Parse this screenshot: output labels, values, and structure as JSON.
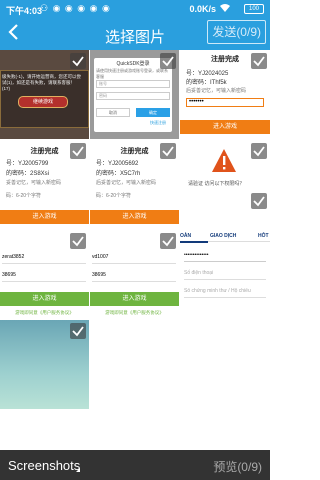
{
  "status": {
    "time": "下午4:03",
    "network": "0.0K/s",
    "battery": "100"
  },
  "header": {
    "title": "选择图片",
    "send_label": "发送(0/9)"
  },
  "thumbs": {
    "t1": {
      "text": "级失败(-1)，请开始运营商，您还可以尝试(1)，如还是有失败，请联系客服！(17)",
      "button": "继续游戏"
    },
    "t2": {
      "title": "QuickSDK登录",
      "hint": "请使用快速注册或游戏账号登录，或联系客服",
      "account": "账号",
      "password": "密码",
      "cancel": "取消",
      "ok": "确定",
      "register": "快速注册"
    },
    "t3": {
      "title": "注册完成",
      "account": "号：YJ2024025",
      "password": "的密码：IThf5k",
      "tip": "后妥善记忆，可输入新密码",
      "field": "•••••••",
      "button": "进入游戏"
    },
    "t4": {
      "title": "注册完成",
      "account": "号：YJ2005799",
      "password": "的密码：2S8Xsi",
      "tip": "妥善记忆，可输入新密码",
      "field": "码：6-20个字符",
      "button": "进入游戏"
    },
    "t5": {
      "title": "注册完成",
      "account": "号：YJ2005692",
      "password": "的密码：X5C7rh",
      "tip": "后妥善记忆，可输入新密码",
      "field": "码：6-20个字符",
      "button": "进入游戏"
    },
    "t6": {
      "message": "请验证 访问以下权限吗？",
      "tab1": "OÀN",
      "tab2": "GIAO DỊCH",
      "tab3": "HỖT",
      "field": "••••••••••••••",
      "ph1": "Số điện thoại",
      "ph2": "Số chứng minh thư / Hộ chiếu"
    },
    "t7": {
      "user": "zerat3852",
      "pass": "38695",
      "button": "进入游戏",
      "agree": "游戏即同意《用户服务协议》"
    },
    "t8": {
      "user": "vd1007",
      "pass": "38695",
      "button": "进入游戏",
      "agree": "游戏即同意《用户服务协议》"
    }
  },
  "bottom": {
    "bucket_label": "Screenshots",
    "preview_label": "预览(0/9)"
  },
  "colors": {
    "primary": "#2a9fde",
    "orange": "#f07d14",
    "green": "#6eb43f",
    "bar": "#333333"
  }
}
